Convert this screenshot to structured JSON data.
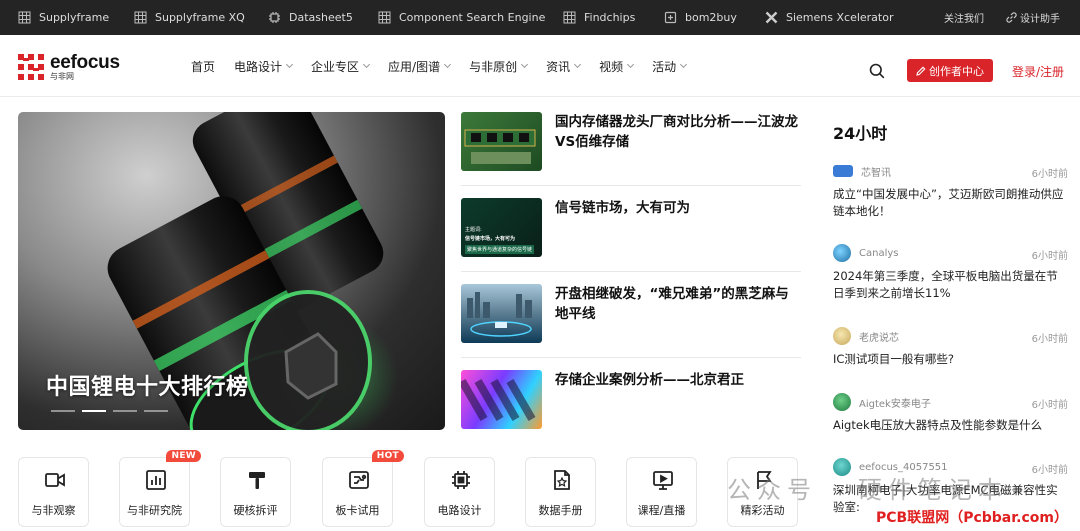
{
  "topbar": {
    "items": [
      {
        "label": "Supplyframe",
        "icon": "grid-icon"
      },
      {
        "label": "Supplyframe XQ",
        "icon": "grid-icon"
      },
      {
        "label": "Datasheet5",
        "icon": "chip-icon"
      },
      {
        "label": "Component Search Engine",
        "icon": "grid-icon"
      },
      {
        "label": "Findchips",
        "icon": "grid-icon"
      },
      {
        "label": "bom2buy",
        "icon": "box-icon"
      },
      {
        "label": "Siemens Xcelerator",
        "icon": "x-logo-icon"
      }
    ],
    "follow": "关注我们",
    "designer": "设计助手"
  },
  "header": {
    "logo_en": "eefocus",
    "logo_cn": "与非网",
    "nav": [
      {
        "label": "首页",
        "dropdown": false
      },
      {
        "label": "电路设计",
        "dropdown": true
      },
      {
        "label": "企业专区",
        "dropdown": true
      },
      {
        "label": "应用/图谱",
        "dropdown": true
      },
      {
        "label": "与非原创",
        "dropdown": true
      },
      {
        "label": "资讯",
        "dropdown": true
      },
      {
        "label": "视频",
        "dropdown": true
      },
      {
        "label": "活动",
        "dropdown": true
      }
    ],
    "creator_button": "创作者中心",
    "login": "登录/注册",
    "accent": "#d9242a"
  },
  "hero": {
    "caption": "中国锂电十大排行榜",
    "slides": 4,
    "active_slide": 2
  },
  "news": [
    {
      "title": "国内存储器龙头厂商对比分析——江波龙VS佰维存储"
    },
    {
      "title": "信号链市场，大有可为",
      "thumb_lines": [
        "主题词:",
        "信号链市场，大有可为",
        "聚焦世界与通道复杂的信号链"
      ]
    },
    {
      "title": "开盘相继破发，“难兄难弟”的黑芝麻与地平线"
    },
    {
      "title": "存储企业案例分析——北京君正"
    }
  ],
  "side": {
    "title": "24小时",
    "items": [
      {
        "source": "芯智讯",
        "time": "6小时前",
        "text": "成立“中国发展中心”，艾迈斯欧司朗推动供应链本地化！"
      },
      {
        "source": "Canalys",
        "time": "6小时前",
        "text": "2024年第三季度，全球平板电脑出货量在节日季到来之前增长11%"
      },
      {
        "source": "老虎说芯",
        "time": "6小时前",
        "text": "IC测试项目一般有哪些?"
      },
      {
        "source": "Aigtek安泰电子",
        "time": "6小时前",
        "text": "Aigtek电压放大器特点及性能参数是什么"
      },
      {
        "source": "eefocus_4057551",
        "time": "6小时前",
        "text": "深圳南柯电子|大功率电源EMC电磁兼容性实验室:"
      }
    ]
  },
  "quick": [
    {
      "label": "与非观察",
      "icon": "video-icon",
      "badge": ""
    },
    {
      "label": "与非研究院",
      "icon": "bar-chart-icon",
      "badge": "NEW"
    },
    {
      "label": "硬核拆评",
      "icon": "hammer-icon",
      "badge": ""
    },
    {
      "label": "板卡试用",
      "icon": "board-icon",
      "badge": "HOT"
    },
    {
      "label": "电路设计",
      "icon": "chip-icon",
      "badge": ""
    },
    {
      "label": "数据手册",
      "icon": "document-icon",
      "badge": ""
    },
    {
      "label": "课程/直播",
      "icon": "monitor-play-icon",
      "badge": ""
    },
    {
      "label": "精彩活动",
      "icon": "flag-icon",
      "badge": ""
    }
  ],
  "watermark": {
    "text": "公众号 · 硬件笔记本",
    "site": "PCB联盟网（Pcbbar.com）"
  }
}
